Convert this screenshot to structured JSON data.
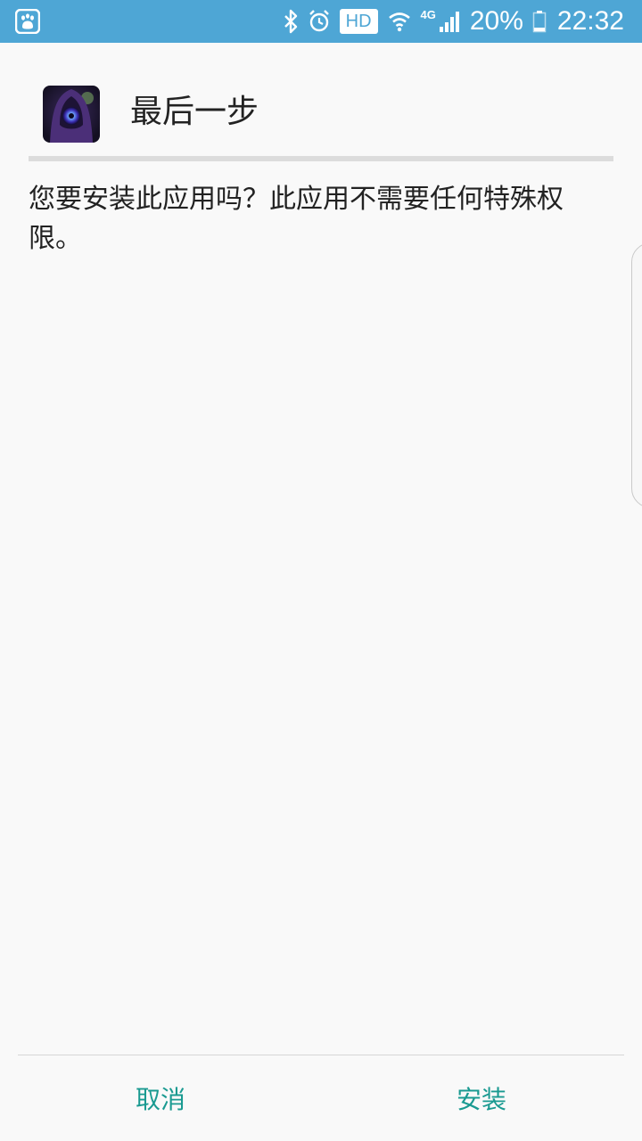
{
  "status_bar": {
    "icons": [
      "baidu-paw-icon",
      "bluetooth-icon",
      "alarm-icon",
      "hd-badge",
      "wifi-icon",
      "signal-icon",
      "battery-icon"
    ],
    "hd_label": "HD",
    "network_label": "4G",
    "battery_percent": "20%",
    "battery_level": 0.2,
    "time": "22:32",
    "background_color": "#4ea6d5"
  },
  "dialog": {
    "title": "最后一步",
    "message": "您要安装此应用吗？此应用不需要任何特殊权限。"
  },
  "buttons": {
    "cancel_label": "取消",
    "install_label": "安装",
    "accent_color": "#1a9a91"
  }
}
